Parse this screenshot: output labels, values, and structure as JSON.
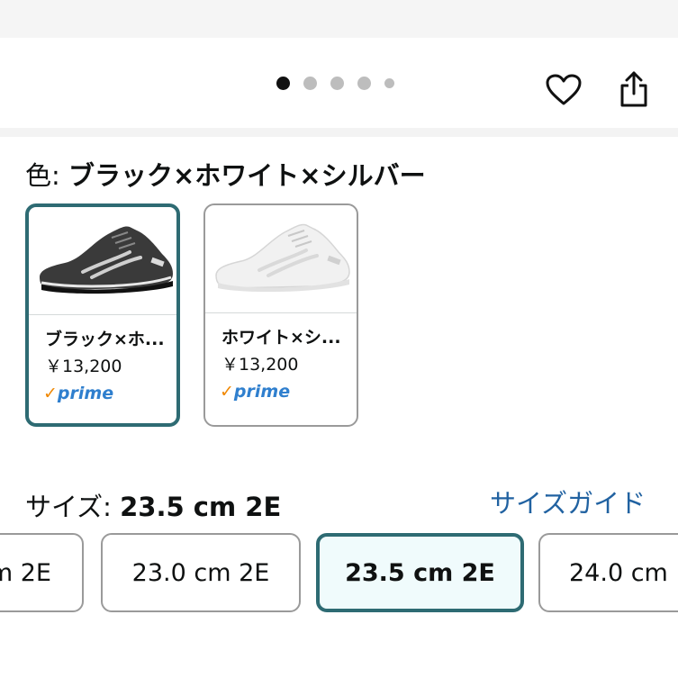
{
  "carousel": {
    "dots": [
      {
        "state": "active"
      },
      {
        "state": "inactive"
      },
      {
        "state": "inactive"
      },
      {
        "state": "inactive"
      },
      {
        "state": "small"
      }
    ],
    "icons": {
      "favorite": "heart-icon",
      "share": "share-icon"
    }
  },
  "color": {
    "label": "色: ",
    "selected": "ブラック×ホワイト×シルバー",
    "options": [
      {
        "name": "ブラック×ホ...",
        "price": "￥13,200",
        "prime": "prime",
        "selected": true
      },
      {
        "name": "ホワイト×シ...",
        "price": "￥13,200",
        "prime": "prime",
        "selected": false
      }
    ]
  },
  "size": {
    "label": "サイズ: ",
    "selected": "23.5 cm 2E",
    "guide_link": "サイズガイド",
    "options": [
      {
        "label": "m 2E",
        "selected": false
      },
      {
        "label": "23.0 cm 2E",
        "selected": false
      },
      {
        "label": "23.5 cm 2E",
        "selected": true
      },
      {
        "label": "24.0 cm",
        "selected": false
      }
    ]
  },
  "colors": {
    "accent_border": "#2e6b73",
    "link": "#2162a1",
    "prime_blue": "#2f7fce",
    "prime_check": "#f08804"
  }
}
